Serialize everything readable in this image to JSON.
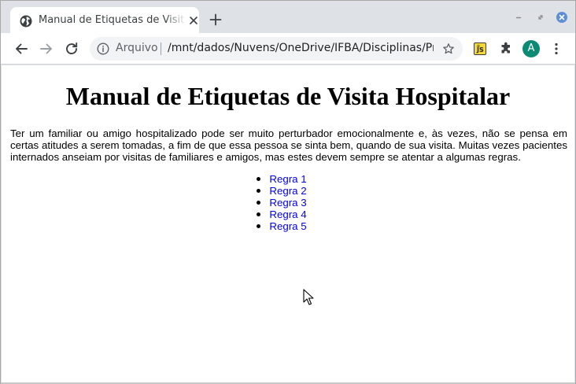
{
  "browser": {
    "tab": {
      "title": "Manual de Etiquetas de Visita Hospitalar"
    },
    "omnibox": {
      "security_chip": "Arquivo",
      "url": "/mnt/dados/Nuvens/OneDrive/IFBA/Disciplinas/Pr..."
    },
    "profile": {
      "initial": "A",
      "color": "#0b8a74"
    },
    "extension_js_label": "JS"
  },
  "page": {
    "heading": "Manual de Etiquetas de Visita Hospitalar",
    "intro": "Ter um familiar ou amigo hospitalizado pode ser muito perturbador emocionalmente e, às vezes, não se pensa em certas atitudes a serem tomadas, a fim de que essa pessoa se sinta bem, quando de sua visita. Muitas vezes pacientes internados anseiam por visitas de familiares e amigos, mas estes devem sempre se atentar a algumas regras.",
    "rules": [
      "Regra 1",
      "Regra 2",
      "Regra 3",
      "Regra 4",
      "Regra 5"
    ],
    "link_color": "#0000ee"
  }
}
